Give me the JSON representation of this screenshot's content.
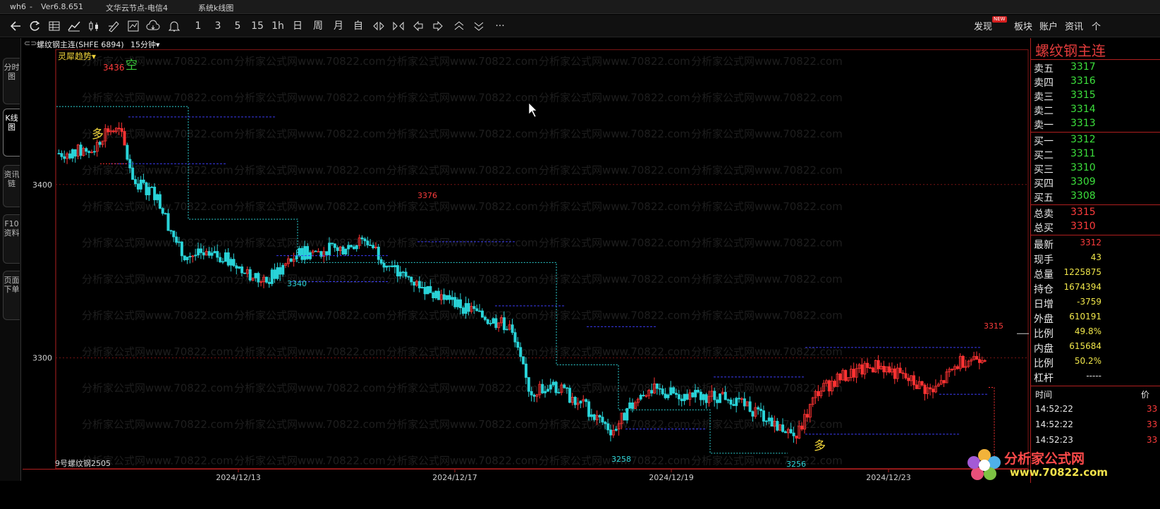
{
  "titlebar": {
    "app": "wh6",
    "version": "Ver6.8.651",
    "server": "文华云节点-电信4",
    "menu": "系统k线图",
    "min": "—",
    "max": "□",
    "close": "×"
  },
  "toolbar": {
    "periods": [
      "1",
      "3",
      "5",
      "15",
      "1h",
      "日",
      "周",
      "月",
      "自"
    ],
    "more": "···",
    "right_items": [
      "发现",
      "板块",
      "账户",
      "资讯",
      "个"
    ],
    "new_badge": "NEW"
  },
  "left_tabs": [
    {
      "label": "分时图",
      "active": false
    },
    {
      "label": "K线图",
      "active": true
    },
    {
      "label": "资讯链",
      "active": false
    },
    {
      "label": "F10资料",
      "active": false
    },
    {
      "label": "页面下单",
      "active": false
    }
  ],
  "chart_header": {
    "symbol": "螺纹钢主连(SHFE 6894)",
    "period": "15分钟▾",
    "indicator": "灵犀趋势▾"
  },
  "chart_data": {
    "type": "candlestick",
    "y_ticks": [
      3400,
      3300
    ],
    "ylim": [
      3236,
      3478
    ],
    "x_ticks": [
      "2024/12/13",
      "2024/12/17",
      "2024/12/19",
      "2024/12/23"
    ],
    "annotations": {
      "high_labels": [
        "3436",
        "3376",
        "3315"
      ],
      "low_labels": [
        "3340",
        "3258",
        "3256"
      ],
      "signals": [
        "空",
        "多",
        "多"
      ],
      "contract_label": "9号螺纹钢2505"
    },
    "trend_steps": [
      3445,
      3380,
      3355,
      3296,
      3270,
      3245
    ],
    "colors": {
      "up": "#ff3333",
      "down": "#29d3d8",
      "trend": "#2dd3d6",
      "support": "#3a3af0",
      "grid": "#7a1414"
    }
  },
  "watermark": "分析家公式网www.70822.com",
  "order_book": {
    "title": "螺纹钢主连",
    "asks": [
      {
        "label": "卖五",
        "price": "3317"
      },
      {
        "label": "卖四",
        "price": "3316"
      },
      {
        "label": "卖三",
        "price": "3315"
      },
      {
        "label": "卖二",
        "price": "3314"
      },
      {
        "label": "卖一",
        "price": "3313"
      }
    ],
    "bids": [
      {
        "label": "买一",
        "price": "3312"
      },
      {
        "label": "买二",
        "price": "3311"
      },
      {
        "label": "买三",
        "price": "3310"
      },
      {
        "label": "买四",
        "price": "3309"
      },
      {
        "label": "买五",
        "price": "3308"
      }
    ],
    "totals": [
      {
        "label": "总卖",
        "value": "3315"
      },
      {
        "label": "总买",
        "value": "3310"
      }
    ],
    "stats": [
      {
        "label": "最新",
        "value": "3312",
        "color": "#ff3c3c"
      },
      {
        "label": "现手",
        "value": "43",
        "color": "#f0e64a"
      },
      {
        "label": "总量",
        "value": "1225875",
        "color": "#f0e64a"
      },
      {
        "label": "持仓",
        "value": "1674394",
        "color": "#f0e64a"
      },
      {
        "label": "日增",
        "value": "-3759",
        "color": "#f0e64a"
      },
      {
        "label": "外盘",
        "value": "610191",
        "color": "#f0e64a"
      },
      {
        "label": "比例",
        "value": "49.8%",
        "color": "#f0e64a"
      },
      {
        "label": "内盘",
        "value": "615684",
        "color": "#f0e64a"
      },
      {
        "label": "比例",
        "value": "50.2%",
        "color": "#f0e64a"
      },
      {
        "label": "杠杆",
        "value": "-----",
        "color": "#e8e8e8"
      }
    ],
    "trades_header": {
      "time": "时间",
      "price": "价"
    },
    "trades": [
      {
        "time": "14:52:22",
        "price": "33"
      },
      {
        "time": "14:52:22",
        "price": "33"
      },
      {
        "time": "14:52:23",
        "price": "33"
      }
    ]
  },
  "logo": {
    "name": "分析家公式网",
    "url": "www.70822.com"
  }
}
